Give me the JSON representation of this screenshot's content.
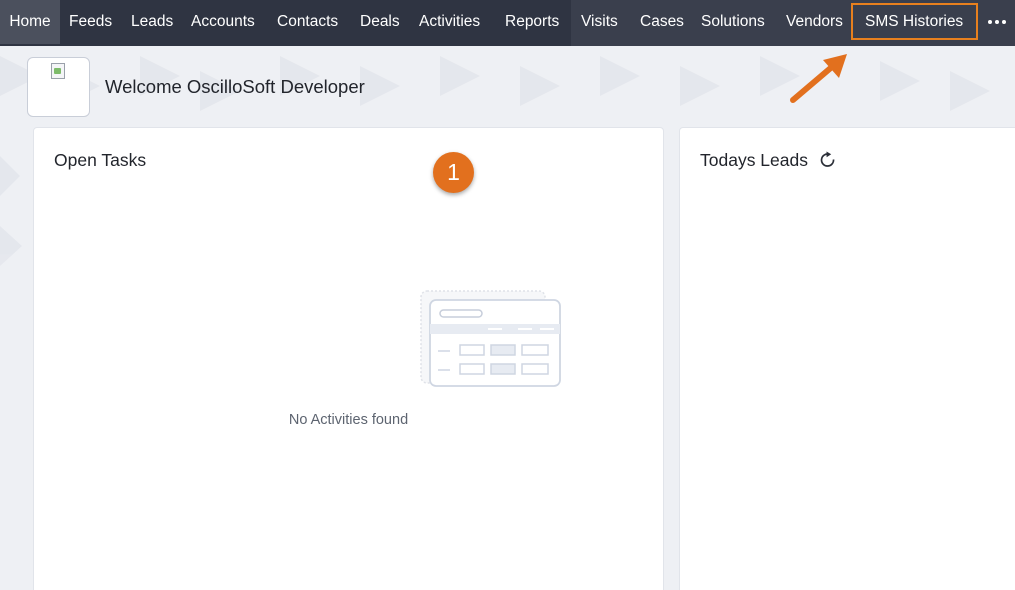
{
  "nav": {
    "items": [
      {
        "label": "Home",
        "active": true
      },
      {
        "label": "Feeds"
      },
      {
        "label": "Leads"
      },
      {
        "label": "Accounts"
      },
      {
        "label": "Contacts"
      },
      {
        "label": "Deals"
      },
      {
        "label": "Activities"
      },
      {
        "label": "Reports"
      },
      {
        "label": "Visits"
      },
      {
        "label": "Cases"
      },
      {
        "label": "Solutions"
      },
      {
        "label": "Vendors"
      },
      {
        "label": "SMS Histories",
        "highlighted": true
      }
    ],
    "more_icon": "more-horizontal-icon"
  },
  "welcome": {
    "text": "Welcome OscilloSoft Developer"
  },
  "open_tasks": {
    "title": "Open Tasks",
    "empty_text": "No Activities found"
  },
  "todays_leads": {
    "title": "Todays Leads",
    "refresh_icon": "refresh-icon"
  },
  "annotation": {
    "step_number": "1",
    "highlight_color": "#e8801e"
  },
  "colors": {
    "nav_bg": "#2f3442",
    "accent_orange": "#e2701e"
  }
}
